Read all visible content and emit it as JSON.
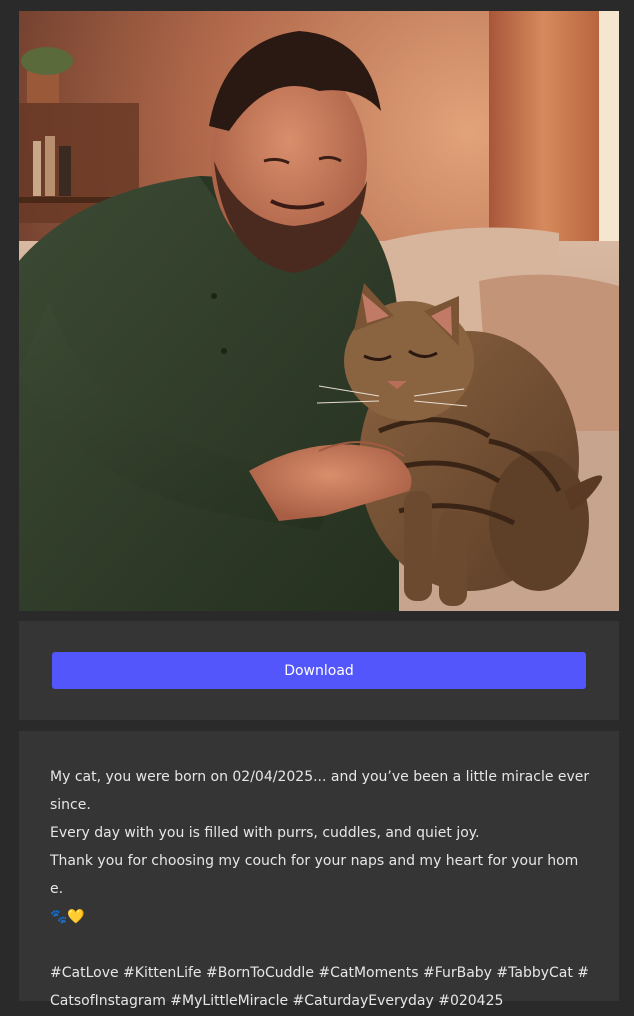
{
  "post": {
    "image": {
      "alt": "Man smiling while petting a tabby cat on a couch"
    },
    "download_label": "Download",
    "caption": {
      "line1": "My cat, you were born on 02/04/2025... and you’ve been a little miracle ever since.",
      "line2": "Every day with you is filled with purrs, cuddles, and quiet joy.",
      "line3": "Thank you for choosing my couch for your naps and my heart for your home.",
      "emoji": "🐾💛",
      "hashtags": "#CatLove #KittenLife #BornToCuddle #CatMoments #FurBaby #TabbyCat #CatsofInstagram #MyLittleMiracle #CaturdayEveryday #020425"
    }
  },
  "colors": {
    "page_background": "#2a2a2a",
    "panel_background": "#353535",
    "accent_button": "#5356fb",
    "text": "#e6e6e6"
  }
}
